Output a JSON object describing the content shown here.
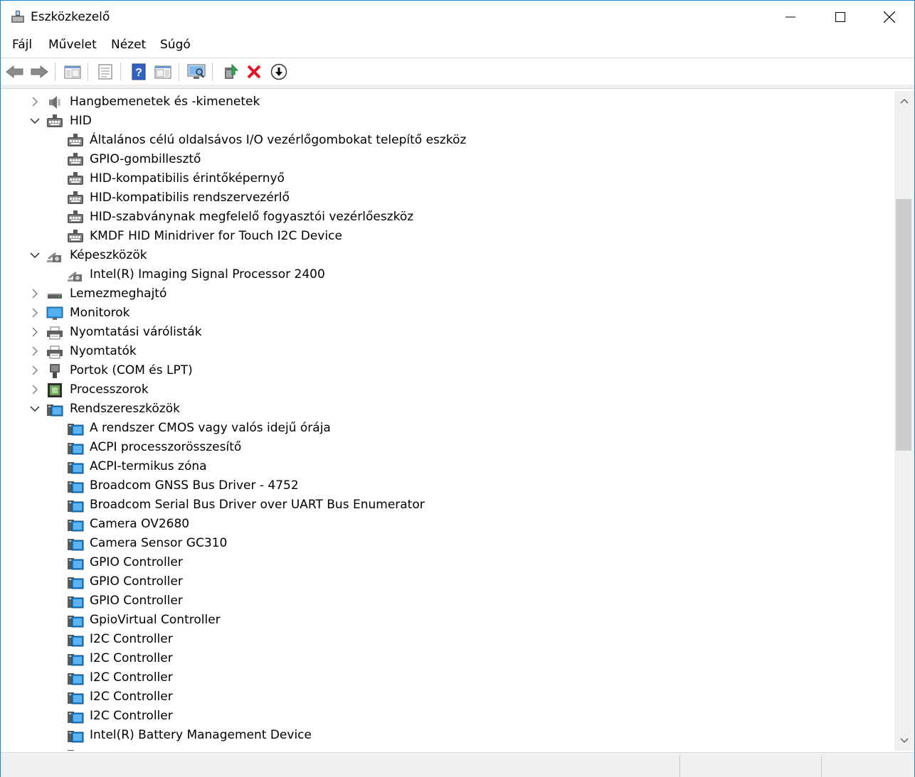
{
  "window": {
    "title": "Eszközkezelő",
    "icon": "device-manager-icon"
  },
  "menu": {
    "items": [
      "Fájl",
      "Művelet",
      "Nézet",
      "Súgó"
    ]
  },
  "toolbar": {
    "buttons": [
      "back-arrow-icon",
      "forward-arrow-icon",
      "show-hide-console-tree-icon",
      "properties-icon",
      "help-icon",
      "action-pane-icon",
      "scan-hardware-icon",
      "update-driver-icon",
      "uninstall-device-icon",
      "disable-device-icon"
    ]
  },
  "tree": {
    "rows": [
      {
        "label": "Hangbemenetek és -kimenetek",
        "level": 0,
        "expanded": false,
        "icon": "speaker-icon"
      },
      {
        "label": "HID",
        "level": 0,
        "expanded": true,
        "icon": "hid-device-icon"
      },
      {
        "label": "Általános célú oldalsávos I/O vezérlőgombokat telepítő eszköz",
        "level": 1,
        "icon": "hid-device-icon"
      },
      {
        "label": "GPIO-gombillesztő",
        "level": 1,
        "icon": "hid-device-icon"
      },
      {
        "label": "HID-kompatibilis érintőképernyő",
        "level": 1,
        "icon": "hid-device-icon"
      },
      {
        "label": "HID-kompatibilis rendszervezérlő",
        "level": 1,
        "icon": "hid-device-icon"
      },
      {
        "label": "HID-szabványnak megfelelő fogyasztói vezérlőeszköz",
        "level": 1,
        "icon": "hid-device-icon"
      },
      {
        "label": "KMDF HID Minidriver for Touch I2C Device",
        "level": 1,
        "icon": "hid-device-icon"
      },
      {
        "label": "Képeszközök",
        "level": 0,
        "expanded": true,
        "icon": "camera-icon"
      },
      {
        "label": "Intel(R) Imaging Signal Processor 2400",
        "level": 1,
        "icon": "camera-icon"
      },
      {
        "label": "Lemezmeghajtó",
        "level": 0,
        "expanded": false,
        "icon": "disk-drive-icon"
      },
      {
        "label": "Monitorok",
        "level": 0,
        "expanded": false,
        "icon": "monitor-icon"
      },
      {
        "label": "Nyomtatási várólisták",
        "level": 0,
        "expanded": false,
        "icon": "printer-icon"
      },
      {
        "label": "Nyomtatók",
        "level": 0,
        "expanded": false,
        "icon": "printer-icon"
      },
      {
        "label": "Portok (COM és LPT)",
        "level": 0,
        "expanded": false,
        "icon": "port-icon"
      },
      {
        "label": "Processzorok",
        "level": 0,
        "expanded": false,
        "icon": "processor-icon"
      },
      {
        "label": "Rendszereszközök",
        "level": 0,
        "expanded": true,
        "icon": "system-device-icon"
      },
      {
        "label": "A rendszer CMOS vagy valós idejű órája",
        "level": 1,
        "icon": "system-device-icon"
      },
      {
        "label": "ACPI processzorösszesítő",
        "level": 1,
        "icon": "system-device-icon"
      },
      {
        "label": "ACPI-termikus zóna",
        "level": 1,
        "icon": "system-device-icon"
      },
      {
        "label": "Broadcom GNSS Bus Driver - 4752",
        "level": 1,
        "icon": "system-device-icon"
      },
      {
        "label": "Broadcom Serial Bus Driver over UART Bus Enumerator",
        "level": 1,
        "icon": "system-device-icon"
      },
      {
        "label": "Camera OV2680",
        "level": 1,
        "icon": "system-device-icon"
      },
      {
        "label": "Camera Sensor GC310",
        "level": 1,
        "icon": "system-device-icon"
      },
      {
        "label": "GPIO Controller",
        "level": 1,
        "icon": "system-device-icon"
      },
      {
        "label": "GPIO Controller",
        "level": 1,
        "icon": "system-device-icon"
      },
      {
        "label": "GPIO Controller",
        "level": 1,
        "icon": "system-device-icon"
      },
      {
        "label": "GpioVirtual Controller",
        "level": 1,
        "icon": "system-device-icon"
      },
      {
        "label": "I2C Controller",
        "level": 1,
        "icon": "system-device-icon"
      },
      {
        "label": "I2C Controller",
        "level": 1,
        "icon": "system-device-icon"
      },
      {
        "label": "I2C Controller",
        "level": 1,
        "icon": "system-device-icon"
      },
      {
        "label": "I2C Controller",
        "level": 1,
        "icon": "system-device-icon"
      },
      {
        "label": "I2C Controller",
        "level": 1,
        "icon": "system-device-icon"
      },
      {
        "label": "Intel(R) Battery Management Device",
        "level": 1,
        "icon": "system-device-icon"
      },
      {
        "label": "",
        "level": 1,
        "icon": "system-device-icon"
      }
    ]
  },
  "colors": {
    "window_border": "#1883d7",
    "chrome_bg": "#f0f0f0",
    "uninstall_red": "#e81123",
    "monitor_blue": "#2b8fd6"
  }
}
